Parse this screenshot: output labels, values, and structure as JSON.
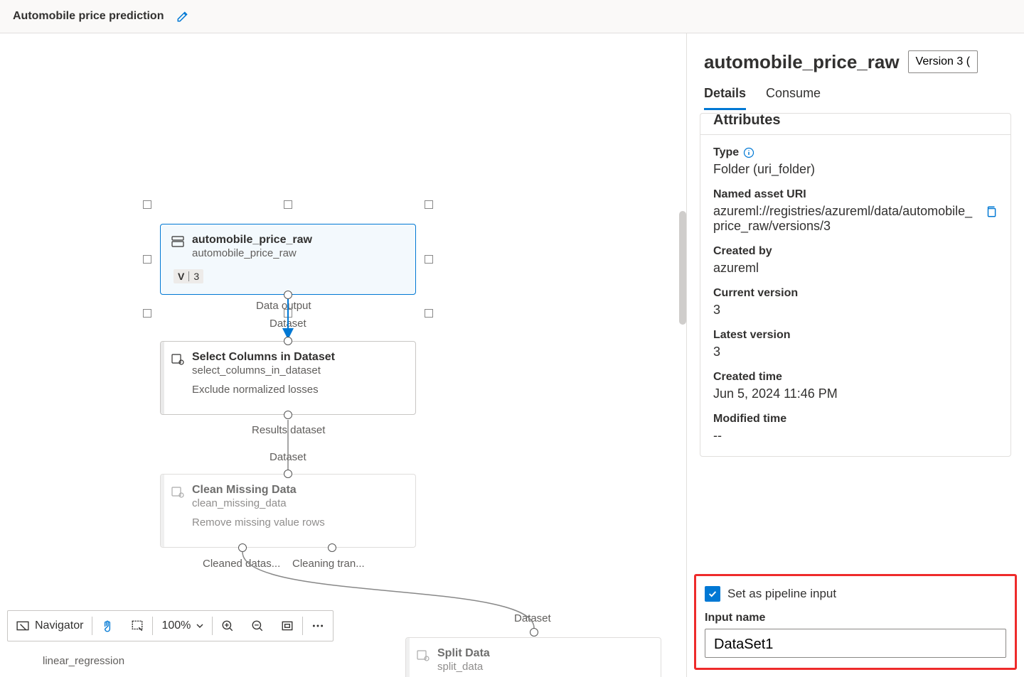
{
  "header": {
    "title": "Automobile price prediction"
  },
  "canvas": {
    "nodes": {
      "dataset": {
        "title": "automobile_price_raw",
        "sub": "automobile_price_raw",
        "versionLabel": "V",
        "version": "3",
        "outLabel": "Data output",
        "outPortSecondary": "Dataset"
      },
      "select": {
        "title": "Select Columns in Dataset",
        "sub": "select_columns_in_dataset",
        "desc": "Exclude normalized losses",
        "inLabel": "Dataset",
        "outLabel": "Results dataset"
      },
      "clean": {
        "title": "Clean Missing Data",
        "sub": "clean_missing_data",
        "desc": "Remove missing value rows",
        "inLabel": "Dataset",
        "outLabel1": "Cleaned datas...",
        "outLabel2": "Cleaning tran..."
      },
      "split": {
        "title": "Split Data",
        "sub": "split_data",
        "inLabel": "Dataset"
      },
      "linreg": "linear_regression"
    },
    "toolbar": {
      "nav": "Navigator",
      "zoom": "100%",
      "more": ""
    }
  },
  "panel": {
    "name": "automobile_price_raw",
    "versionSelect": "Version 3 (",
    "tabs": {
      "details": "Details",
      "consume": "Consume"
    },
    "attrHead": "Attributes",
    "type": {
      "label": "Type",
      "value": "Folder (uri_folder)"
    },
    "uri": {
      "label": "Named asset URI",
      "value": "azureml://registries/azureml/data/automobile_price_raw/versions/3"
    },
    "createdBy": {
      "label": "Created by",
      "value": "azureml"
    },
    "currentVer": {
      "label": "Current version",
      "value": "3"
    },
    "latestVer": {
      "label": "Latest version",
      "value": "3"
    },
    "createdTime": {
      "label": "Created time",
      "value": "Jun 5, 2024 11:46 PM"
    },
    "modifiedTime": {
      "label": "Modified time",
      "value": "--"
    },
    "setInput": "Set as pipeline input",
    "inputNameLabel": "Input name",
    "inputNameValue": "DataSet1"
  }
}
